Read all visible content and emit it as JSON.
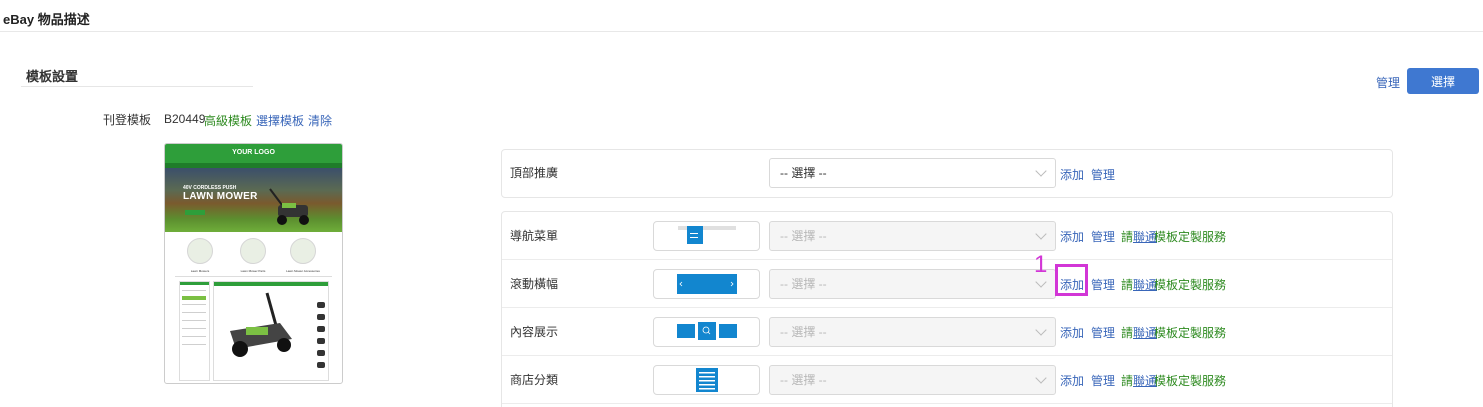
{
  "header": {
    "title": "eBay 物品描述"
  },
  "section": {
    "title": "模板設置"
  },
  "top_actions": {
    "manage": "管理",
    "select": "選擇"
  },
  "template": {
    "label": "刊登模板",
    "code": "B20449",
    "type": "高級模板",
    "choose": "選擇模板",
    "clear": "清除"
  },
  "preview": {
    "logo": "YOUR LOGO",
    "hero_tag": "40V CORDLESS PUSH",
    "hero_title": "LAWN MOWER",
    "product_labels": [
      "Lawn Mowers",
      "Lawn Mower Parts",
      "Lawn Mower Accessories"
    ],
    "main_head": "Product Title",
    "desc_head": "Description"
  },
  "rows": {
    "top_promo": {
      "label": "頂部推廣",
      "select_value": "-- 選擇 --",
      "add": "添加",
      "manage": "管理"
    },
    "nav_menu": {
      "label": "導航菜單",
      "select_value": "-- 選擇 --",
      "add": "添加",
      "manage": "管理",
      "service_1": "請",
      "service_2": "聯通",
      "service_3": "模板定製服務"
    },
    "banner": {
      "label": "滾動橫幅",
      "select_value": "-- 選擇 --",
      "add": "添加",
      "manage": "管理",
      "service_1": "請",
      "service_2": "聯通",
      "service_3": "模板定製服務"
    },
    "content": {
      "label": "內容展示",
      "select_value": "-- 選擇 --",
      "add": "添加",
      "manage": "管理",
      "service_1": "請",
      "service_2": "聯通",
      "service_3": "模板定製服務"
    },
    "store_cat": {
      "label": "商店分類",
      "select_value": "-- 選擇 --",
      "add": "添加",
      "manage": "管理",
      "service_1": "請",
      "service_2": "聯通",
      "service_3": "模板定製服務"
    }
  },
  "annotation": {
    "number": "1"
  },
  "colors": {
    "link": "#3966b9",
    "green": "#2d8a1f",
    "primary": "#3f78d1",
    "highlight": "#d236d6",
    "thumb_blue": "#1286cf"
  }
}
